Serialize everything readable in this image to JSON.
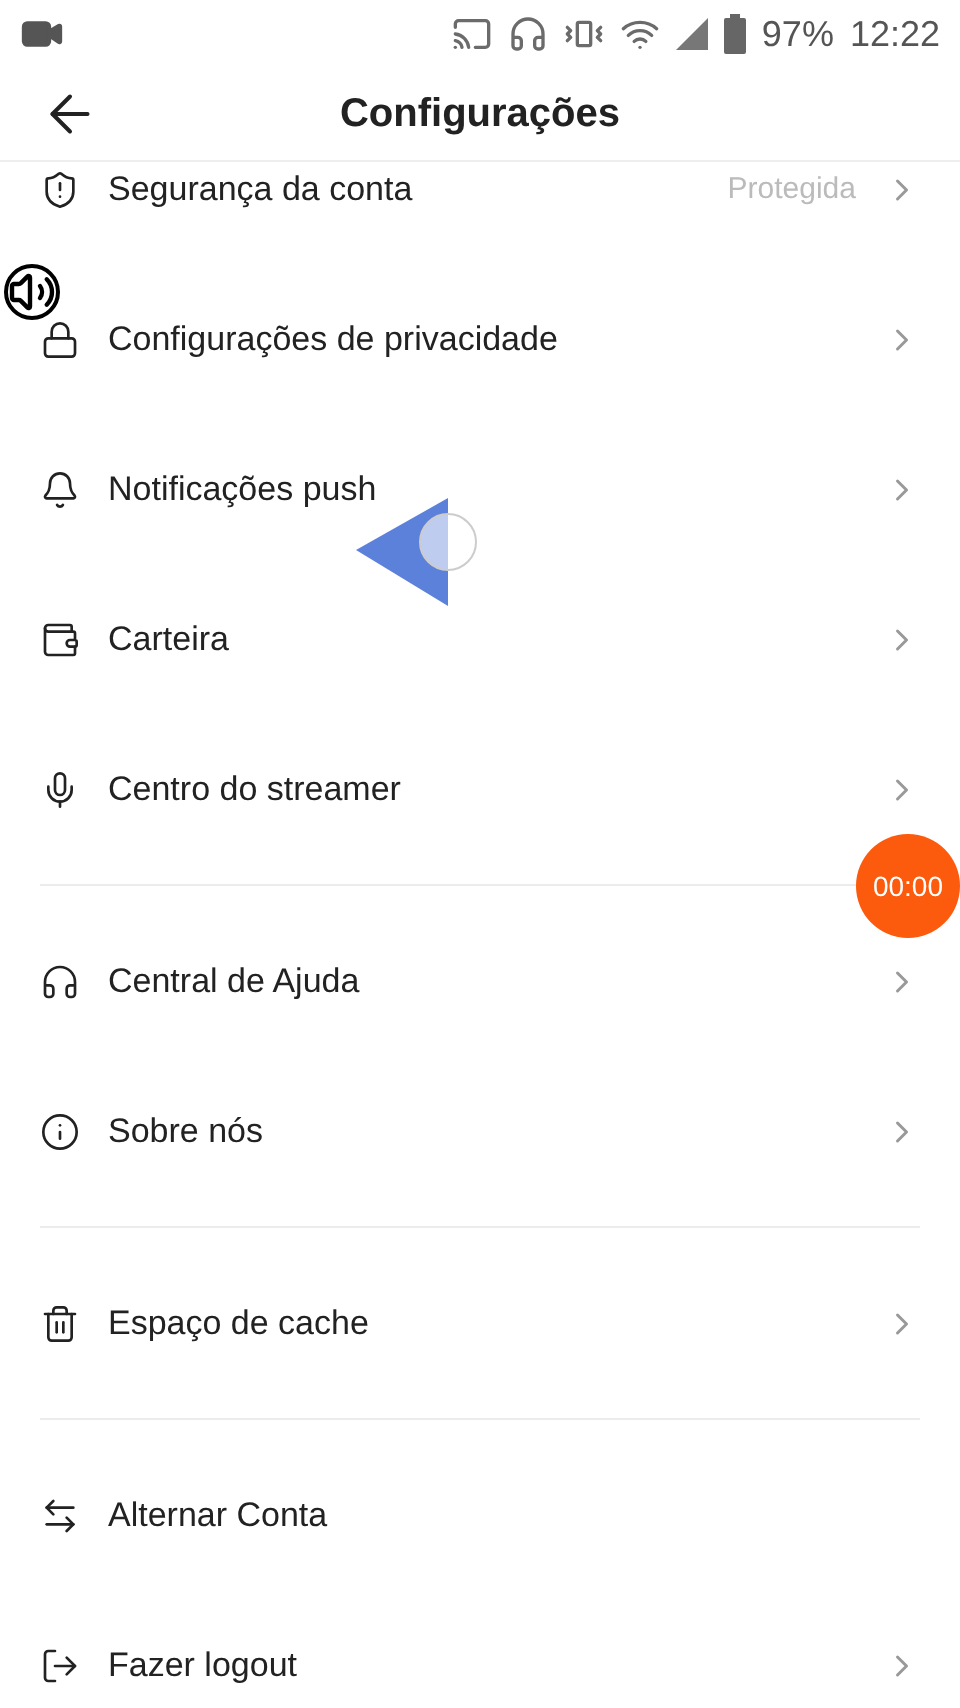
{
  "status_bar": {
    "battery": "97%",
    "time": "12:22"
  },
  "header": {
    "title": "Configurações"
  },
  "sections": [
    {
      "items": [
        {
          "label": "Segurança da conta",
          "value": "Protegida",
          "chevron": true
        },
        {
          "label": "Configurações de privacidade",
          "chevron": true
        },
        {
          "label": "Notificações push",
          "chevron": true
        },
        {
          "label": "Carteira",
          "chevron": true
        },
        {
          "label": "Centro do streamer",
          "chevron": true
        }
      ]
    },
    {
      "items": [
        {
          "label": "Central de Ajuda",
          "chevron": true
        },
        {
          "label": "Sobre nós",
          "chevron": true
        }
      ]
    },
    {
      "items": [
        {
          "label": "Espaço de cache",
          "chevron": true
        }
      ]
    },
    {
      "items": [
        {
          "label": "Alternar Conta",
          "chevron": false
        },
        {
          "label": "Fazer logout",
          "chevron": true
        }
      ]
    }
  ],
  "recorder_timer": "00:00"
}
